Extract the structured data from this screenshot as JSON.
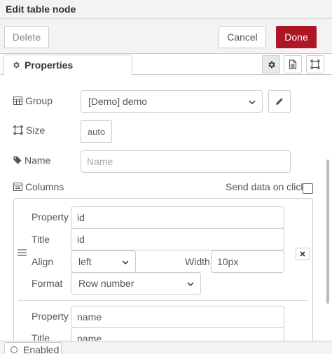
{
  "title": "Edit table node",
  "toolbar": {
    "delete_label": "Delete",
    "cancel_label": "Cancel",
    "done_label": "Done"
  },
  "tabs": {
    "properties_label": "Properties"
  },
  "form": {
    "group_label": "Group",
    "group_value": "[Demo] demo",
    "size_label": "Size",
    "size_value": "auto",
    "name_label": "Name",
    "name_placeholder": "Name",
    "columns_label": "Columns",
    "send_data_label": "Send data on click"
  },
  "columns": [
    {
      "property_label": "Property",
      "property_value": "id",
      "title_label": "Title",
      "title_value": "id",
      "align_label": "Align",
      "align_value": "left",
      "width_label": "Width",
      "width_value": "10px",
      "format_label": "Format",
      "format_value": "Row number"
    },
    {
      "property_label": "Property",
      "property_value": "name",
      "title_label": "Title",
      "title_value": "name"
    }
  ],
  "footer": {
    "enabled_label": "Enabled"
  },
  "colors": {
    "done_bg": "#ad1625",
    "bar_bg": "#f3f3f3",
    "border": "#cccccc"
  }
}
